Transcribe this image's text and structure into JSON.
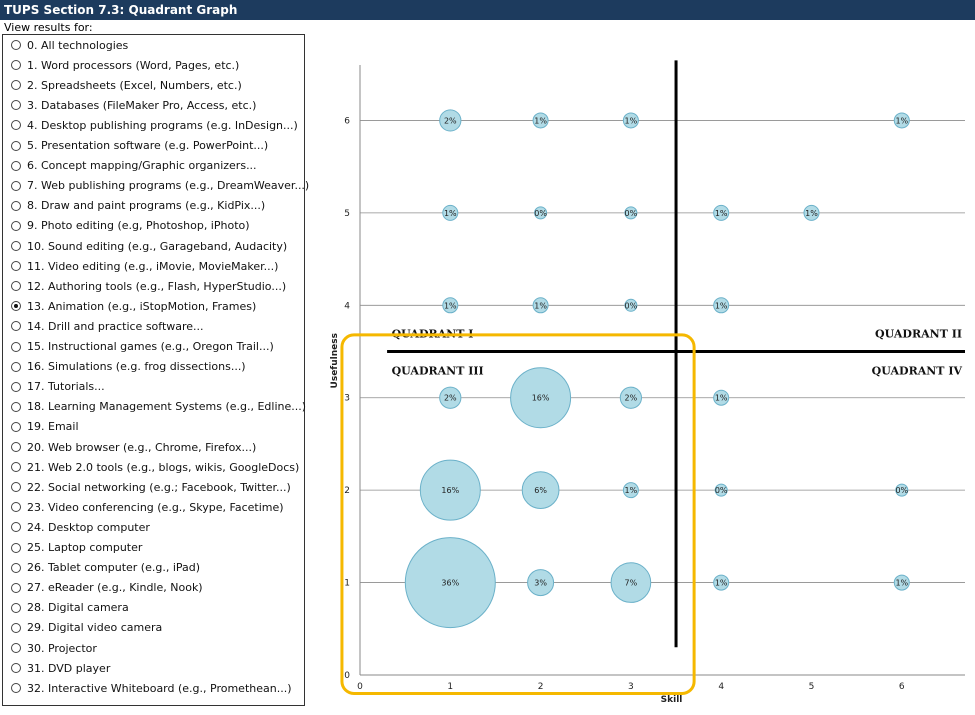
{
  "header": {
    "title": "TUPS Section 7.3: Quadrant Graph"
  },
  "filter": {
    "label": "View results for:",
    "selected_index": 13,
    "options": [
      "0. All technologies",
      "1. Word processors (Word, Pages, etc.)",
      "2. Spreadsheets (Excel, Numbers, etc.)",
      "3. Databases (FileMaker Pro, Access, etc.)",
      "4. Desktop publishing programs (e.g. InDesign...)",
      "5. Presentation software (e.g. PowerPoint...)",
      "6. Concept mapping/Graphic organizers...",
      "7. Web publishing programs (e.g., DreamWeaver...)",
      "8. Draw and paint programs (e.g., KidPix...)",
      "9. Photo editing (e.g, Photoshop, iPhoto)",
      "10. Sound editing (e.g., Garageband, Audacity)",
      "11. Video editing (e.g., iMovie, MovieMaker...)",
      "12. Authoring tools (e.g., Flash, HyperStudio...)",
      "13. Animation (e.g., iStopMotion, Frames)",
      "14. Drill and practice software...",
      "15. Instructional games (e.g., Oregon Trail...)",
      "16. Simulations (e.g. frog dissections...)",
      "17. Tutorials...",
      "18. Learning Management Systems (e.g., Edline...)",
      "19. Email",
      "20. Web browser (e.g., Chrome, Firefox...)",
      "21. Web 2.0 tools (e.g., blogs, wikis, GoogleDocs)",
      "22. Social networking (e.g.; Facebook, Twitter...)",
      "23. Video conferencing (e.g., Skype, Facetime)",
      "24. Desktop computer",
      "25. Laptop computer",
      "26. Tablet computer (e.g., iPad)",
      "27. eReader (e.g., Kindle, Nook)",
      "28. Digital camera",
      "29. Digital video camera",
      "30. Projector",
      "31. DVD player",
      "32. Interactive Whiteboard (e.g., Promethean...)"
    ]
  },
  "chart_data": {
    "type": "scatter",
    "xlabel": "Skill",
    "ylabel": "Usefulness",
    "xlim": [
      0,
      6.7
    ],
    "ylim": [
      0,
      6.6
    ],
    "x_ticks": [
      "0",
      "1",
      "2",
      "3",
      "4",
      "5",
      "6"
    ],
    "y_ticks": [
      "0",
      "1",
      "2",
      "3",
      "4",
      "5",
      "6"
    ],
    "grid": "horizontal",
    "quadrant_x": 3.5,
    "quadrant_y": 3.5,
    "quadrant_labels": [
      "QUADRANT I",
      "QUADRANT II",
      "QUADRANT III",
      "QUADRANT IV"
    ],
    "highlight_quadrant": "QUADRANT III",
    "points": [
      {
        "x": 1,
        "y": 6,
        "pct": 2,
        "label": "2%"
      },
      {
        "x": 2,
        "y": 6,
        "pct": 1,
        "label": "1%"
      },
      {
        "x": 3,
        "y": 6,
        "pct": 1,
        "label": "1%"
      },
      {
        "x": 6,
        "y": 6,
        "pct": 1,
        "label": "1%"
      },
      {
        "x": 1,
        "y": 5,
        "pct": 1,
        "label": "1%"
      },
      {
        "x": 2,
        "y": 5,
        "pct": 0,
        "label": "0%"
      },
      {
        "x": 3,
        "y": 5,
        "pct": 0,
        "label": "0%"
      },
      {
        "x": 4,
        "y": 5,
        "pct": 1,
        "label": "1%"
      },
      {
        "x": 5,
        "y": 5,
        "pct": 1,
        "label": "1%"
      },
      {
        "x": 1,
        "y": 4,
        "pct": 1,
        "label": "1%"
      },
      {
        "x": 2,
        "y": 4,
        "pct": 1,
        "label": "1%"
      },
      {
        "x": 3,
        "y": 4,
        "pct": 0,
        "label": "0%"
      },
      {
        "x": 4,
        "y": 4,
        "pct": 1,
        "label": "1%"
      },
      {
        "x": 1,
        "y": 3,
        "pct": 2,
        "label": "2%"
      },
      {
        "x": 2,
        "y": 3,
        "pct": 16,
        "label": "16%"
      },
      {
        "x": 3,
        "y": 3,
        "pct": 2,
        "label": "2%"
      },
      {
        "x": 4,
        "y": 3,
        "pct": 1,
        "label": "1%"
      },
      {
        "x": 1,
        "y": 2,
        "pct": 16,
        "label": "16%"
      },
      {
        "x": 2,
        "y": 2,
        "pct": 6,
        "label": "6%"
      },
      {
        "x": 3,
        "y": 2,
        "pct": 1,
        "label": "1%"
      },
      {
        "x": 4,
        "y": 2,
        "pct": 0,
        "label": "0%"
      },
      {
        "x": 6,
        "y": 2,
        "pct": 0,
        "label": "0%"
      },
      {
        "x": 1,
        "y": 1,
        "pct": 36,
        "label": "36%"
      },
      {
        "x": 2,
        "y": 1,
        "pct": 3,
        "label": "3%"
      },
      {
        "x": 3,
        "y": 1,
        "pct": 7,
        "label": "7%"
      },
      {
        "x": 4,
        "y": 1,
        "pct": 1,
        "label": "1%"
      },
      {
        "x": 6,
        "y": 1,
        "pct": 1,
        "label": "1%"
      }
    ]
  },
  "colors": {
    "header_bg": "#1d3b5e",
    "bubble_fill": "#b1dbe6",
    "bubble_stroke": "#6bb1c9",
    "highlight": "#f5b800"
  }
}
